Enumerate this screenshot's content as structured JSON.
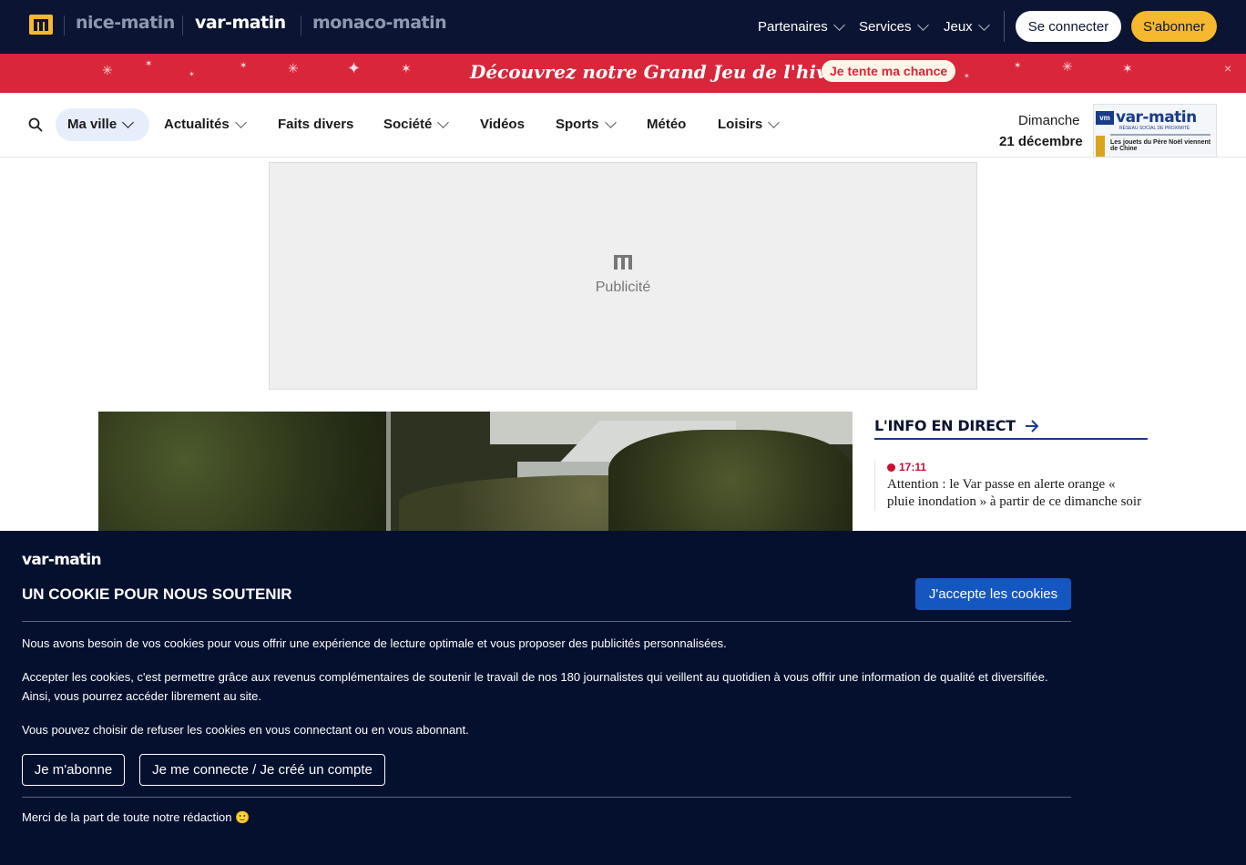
{
  "topbar": {
    "brands": [
      "nice-matin",
      "var-matin",
      "monaco-matin"
    ],
    "menu": [
      {
        "label": "Partenaires"
      },
      {
        "label": "Services"
      },
      {
        "label": "Jeux"
      }
    ],
    "login_label": "Se connecter",
    "subscribe_label": "S'abonner",
    "colors": {
      "background": "#0b1432",
      "subscribe": "#f5b82e"
    }
  },
  "promo": {
    "text": "Découvrez notre Grand Jeu de l'hiver !",
    "cta": "Je tente ma chance",
    "close": "×",
    "background": "#d9263a"
  },
  "nav": {
    "items": [
      {
        "label": "Ma ville"
      },
      {
        "label": "Actualités"
      },
      {
        "label": "Faits divers"
      },
      {
        "label": "Société"
      },
      {
        "label": "Vidéos"
      },
      {
        "label": "Sports"
      },
      {
        "label": "Météo"
      },
      {
        "label": "Loisirs"
      }
    ],
    "date_day": "Dimanche",
    "date_full": "21 décembre",
    "cover": {
      "title": "var-matin",
      "subtitle": "RÉSEAU SOCIAL DE PROXIMITÉ",
      "headline": "Les jouets du Père Noël viennent de Chine"
    }
  },
  "ad": {
    "label": "Publicité"
  },
  "sidebar": {
    "title": "L'INFO EN DIRECT",
    "items": [
      {
        "time": "17:11",
        "text": "Attention : le Var passe en alerte orange « pluie inondation » à partir de ce dimanche soir"
      }
    ]
  },
  "cookie": {
    "brand": "var-matin",
    "title": "UN COOKIE POUR NOUS SOUTENIR",
    "accept_label": "J'accepte les cookies",
    "paragraphs": [
      "Nous avons besoin de vos cookies pour vous offrir une expérience de lecture optimale et vous proposer des publicités personnalisées.",
      "Accepter les cookies, c'est permettre grâce aux revenus complémentaires de soutenir le travail de nos 180 journalistes qui veillent au quotidien à vous offrir une information de qualité et diversifiée. Ainsi, vous pourrez accéder librement au site.",
      "Vous pouvez choisir de refuser les cookies en vous connectant ou en vous abonnant."
    ],
    "subscribe_label": "Je m'abonne",
    "login_label": "Je me connecte / Je créé un compte",
    "thanks": "Merci de la part de toute notre rédaction 🙂"
  }
}
